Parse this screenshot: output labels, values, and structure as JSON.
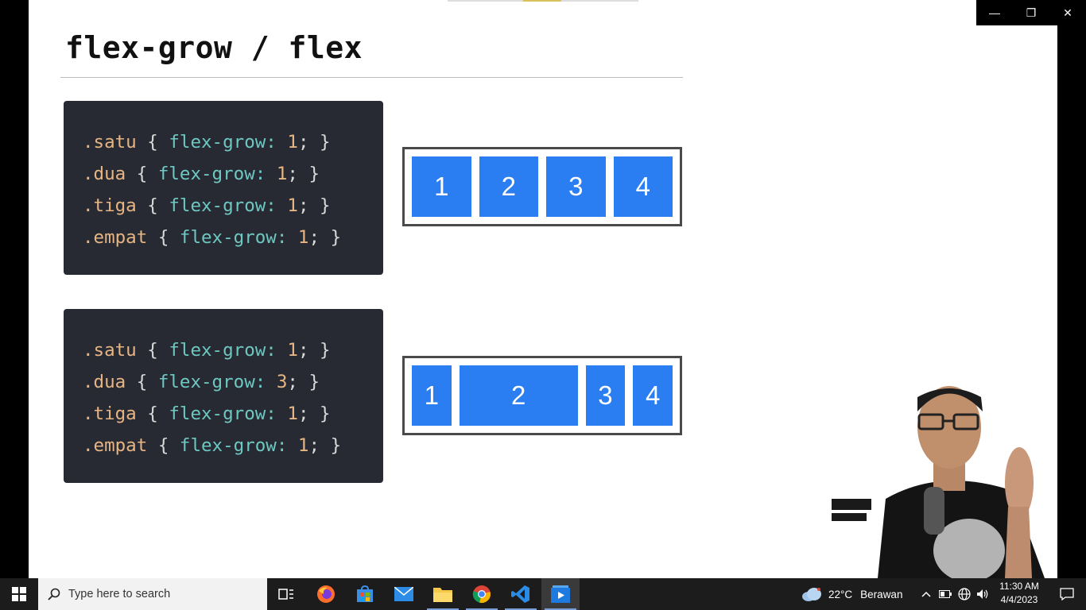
{
  "slide": {
    "title": "flex-grow / flex",
    "panels": [
      {
        "lines": [
          {
            "selector": ".satu",
            "open": " { ",
            "property": "flex-grow:",
            "value": " 1",
            "close": "; }"
          },
          {
            "selector": ".dua",
            "open": " { ",
            "property": "flex-grow:",
            "value": " 1",
            "close": "; }"
          },
          {
            "selector": ".tiga",
            "open": " { ",
            "property": "flex-grow:",
            "value": " 1",
            "close": "; }"
          },
          {
            "selector": ".empat",
            "open": " { ",
            "property": "flex-grow:",
            "value": " 1",
            "close": "; }"
          }
        ]
      },
      {
        "lines": [
          {
            "selector": ".satu",
            "open": " { ",
            "property": "flex-grow:",
            "value": " 1",
            "close": "; }"
          },
          {
            "selector": ".dua",
            "open": " { ",
            "property": "flex-grow:",
            "value": " 3",
            "close": "; }"
          },
          {
            "selector": ".tiga",
            "open": " { ",
            "property": "flex-grow:",
            "value": " 1",
            "close": "; }"
          },
          {
            "selector": ".empat",
            "open": " { ",
            "property": "flex-grow:",
            "value": " 1",
            "close": "; }"
          }
        ]
      }
    ],
    "demos": [
      {
        "items": [
          {
            "label": "1",
            "grow": 1
          },
          {
            "label": "2",
            "grow": 1
          },
          {
            "label": "3",
            "grow": 1
          },
          {
            "label": "4",
            "grow": 1
          }
        ]
      },
      {
        "items": [
          {
            "label": "1",
            "grow": 1
          },
          {
            "label": "2",
            "grow": 3
          },
          {
            "label": "3",
            "grow": 1
          },
          {
            "label": "4",
            "grow": 1
          }
        ]
      }
    ],
    "item_color": "#2a7ef2",
    "code_bg": "#272a33"
  },
  "window_controls": {
    "minimize": "—",
    "restore": "❐",
    "close": "✕"
  },
  "taskbar": {
    "search_placeholder": "Type here to search",
    "apps": [
      "task-view",
      "firefox",
      "microsoft-store",
      "mail",
      "file-explorer",
      "chrome",
      "vscode",
      "video-player"
    ],
    "weather": {
      "temp": "22°C",
      "desc": "Berawan"
    },
    "clock": {
      "time": "11:30 AM",
      "date": "4/4/2023"
    }
  }
}
